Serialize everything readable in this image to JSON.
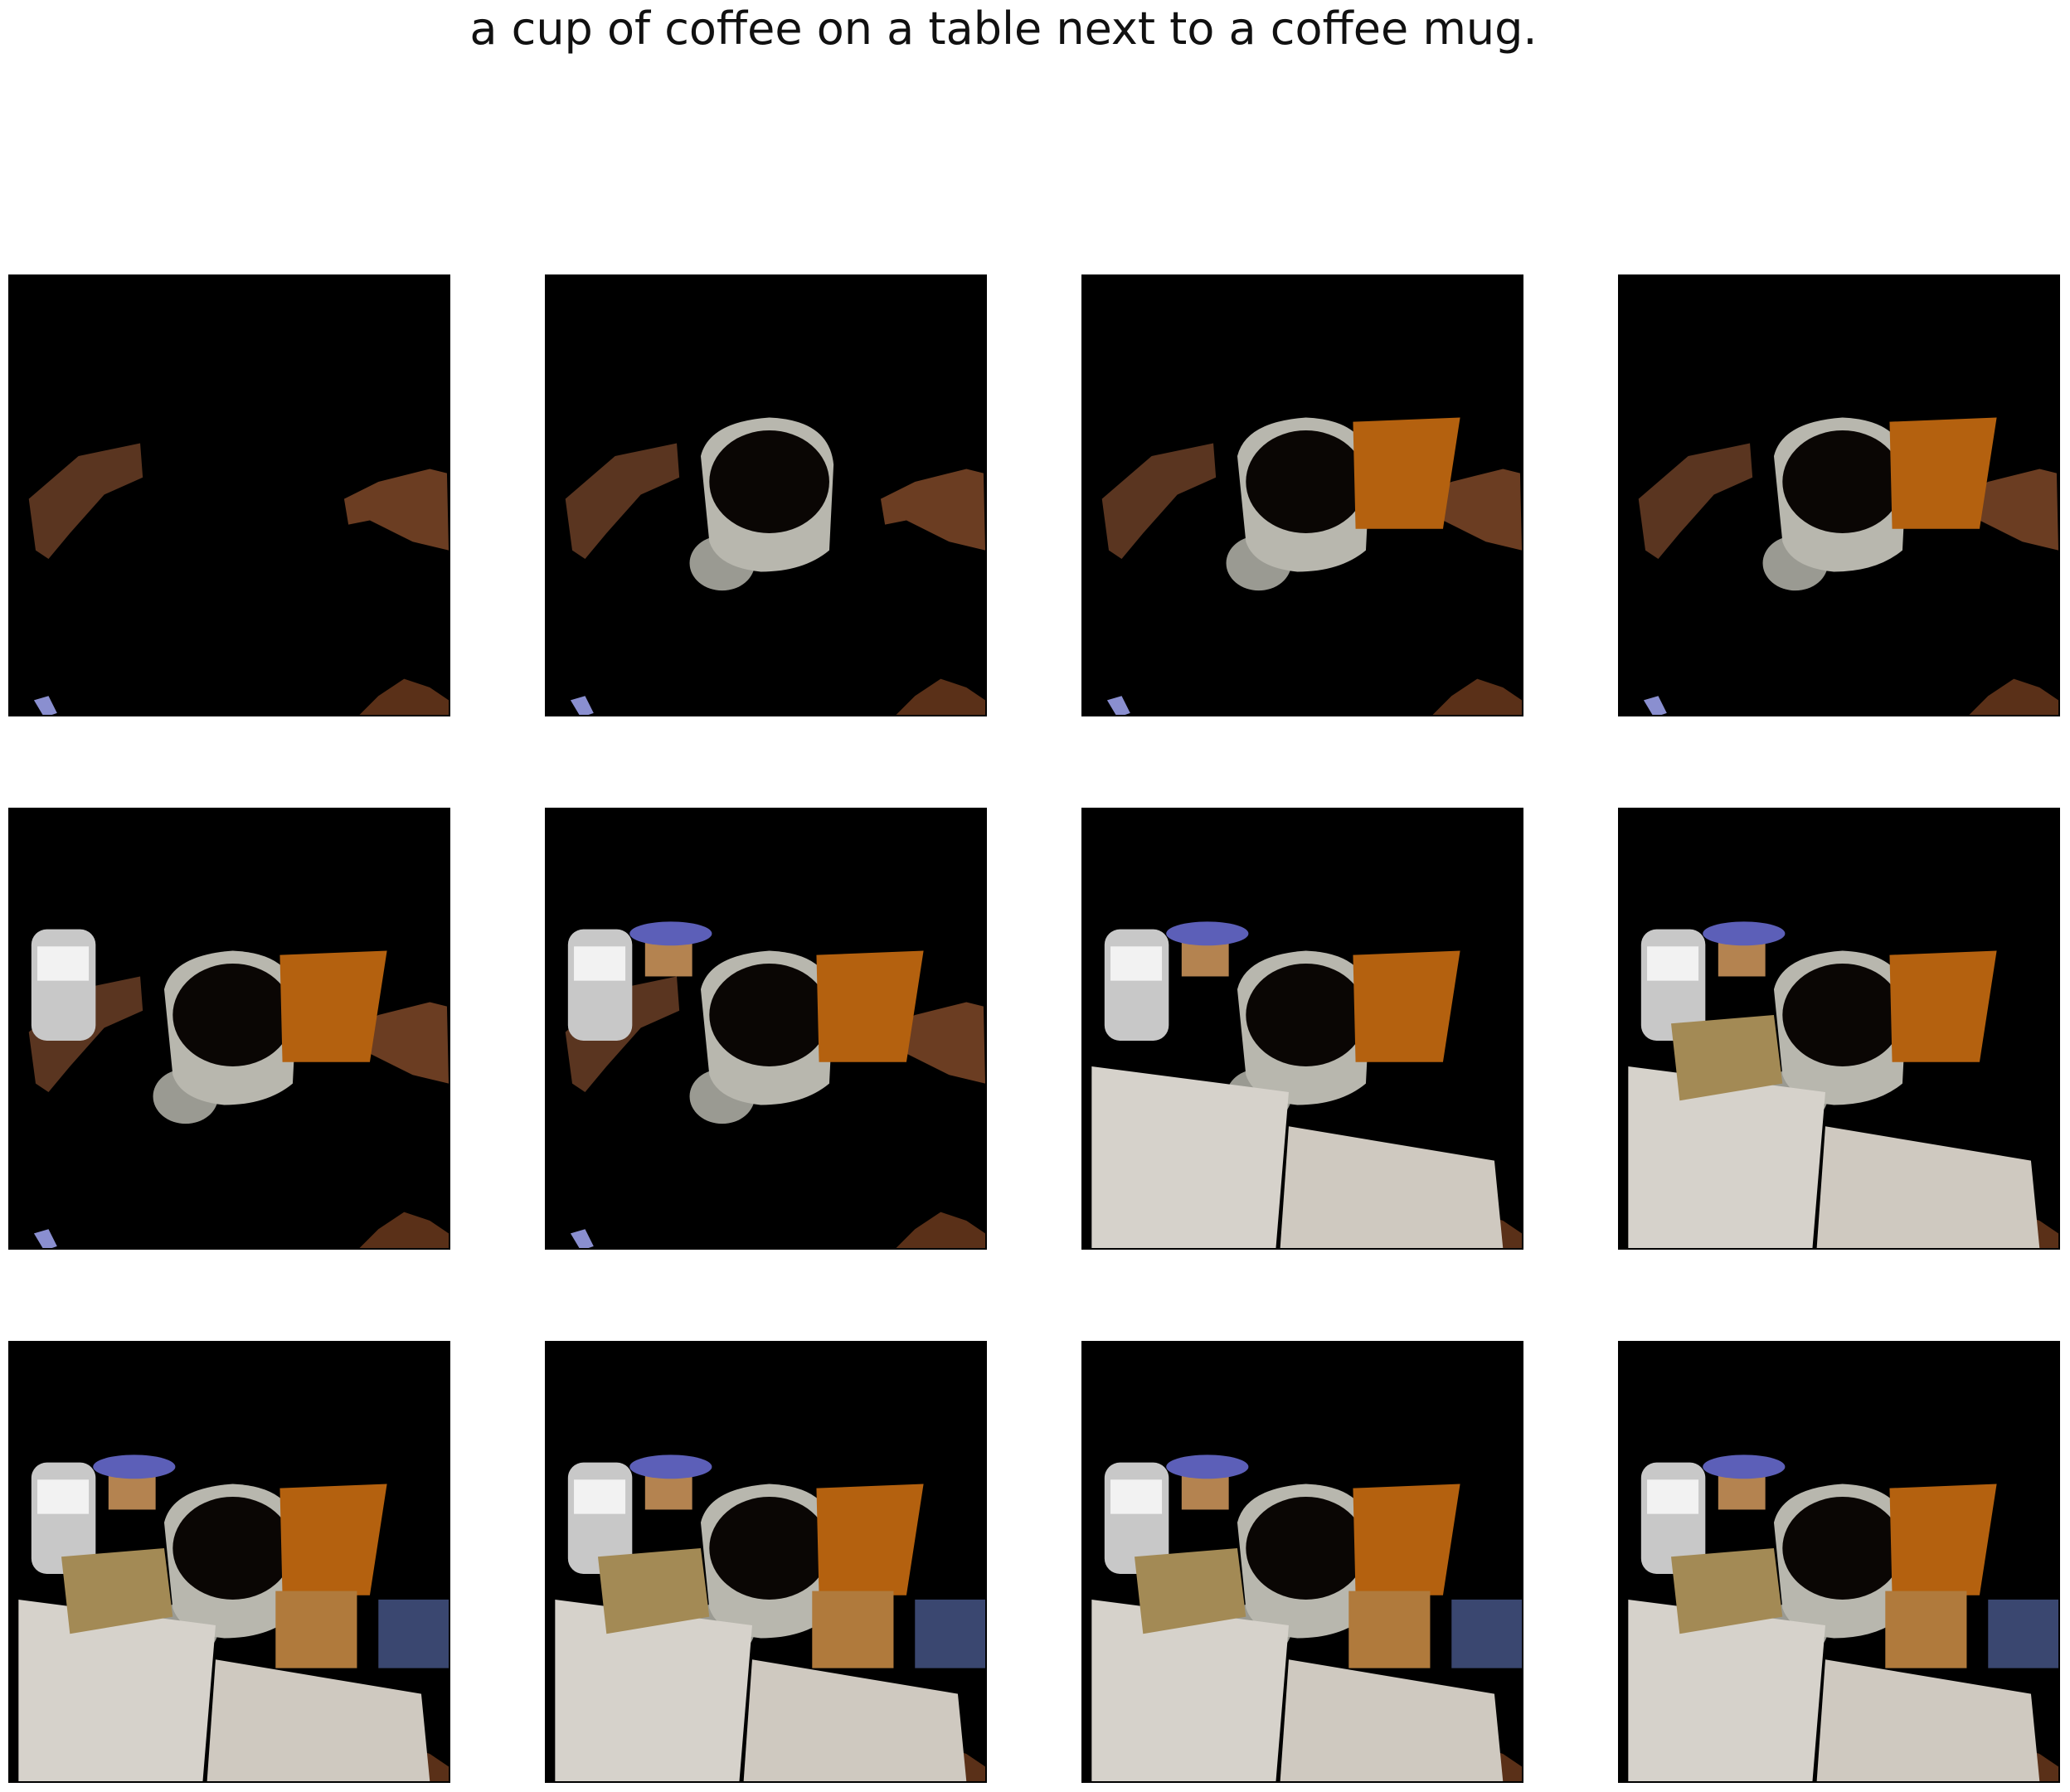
{
  "caption": "a cup of coffee on a table next to a coffee mug.",
  "grid": {
    "rows": 3,
    "cols": 4
  },
  "colors": {
    "background": "#ffffff",
    "panel_bg": "#000000",
    "coffee": "#0a0604",
    "mug": "#b8b7ae",
    "amber_glass": "#b4610f",
    "wood_fragment": "#5a3520",
    "paper": "#d6d2cb",
    "lid_blue": "#5c5fb8",
    "jar": "#c8c8c8",
    "box": "#a38a55",
    "wood_block": "#b07a3c",
    "dark_box": "#3a4770"
  },
  "frames": [
    {
      "index": 1,
      "layers": [
        "fragments"
      ]
    },
    {
      "index": 2,
      "layers": [
        "fragments",
        "mug"
      ]
    },
    {
      "index": 3,
      "layers": [
        "fragments",
        "mug",
        "amber"
      ]
    },
    {
      "index": 4,
      "layers": [
        "fragments",
        "mug",
        "amber"
      ]
    },
    {
      "index": 5,
      "layers": [
        "fragments",
        "mug",
        "amber",
        "jar"
      ]
    },
    {
      "index": 6,
      "layers": [
        "fragments",
        "mug",
        "amber",
        "jar",
        "lid"
      ]
    },
    {
      "index": 7,
      "layers": [
        "fragments",
        "mug",
        "amber",
        "jar",
        "lid",
        "papers"
      ]
    },
    {
      "index": 8,
      "layers": [
        "fragments",
        "mug",
        "amber",
        "jar",
        "lid",
        "papers",
        "box"
      ]
    },
    {
      "index": 9,
      "layers": [
        "fragments",
        "mug",
        "amber",
        "jar",
        "lid",
        "papers",
        "box",
        "block",
        "darkbox"
      ]
    },
    {
      "index": 10,
      "layers": [
        "fragments",
        "mug",
        "amber",
        "jar",
        "lid",
        "papers",
        "box",
        "block",
        "darkbox"
      ]
    },
    {
      "index": 11,
      "layers": [
        "fragments",
        "mug",
        "amber",
        "jar",
        "lid",
        "papers",
        "box",
        "block",
        "darkbox"
      ]
    },
    {
      "index": 12,
      "layers": [
        "fragments",
        "mug",
        "amber",
        "jar",
        "lid",
        "papers",
        "box",
        "block",
        "darkbox"
      ]
    }
  ]
}
